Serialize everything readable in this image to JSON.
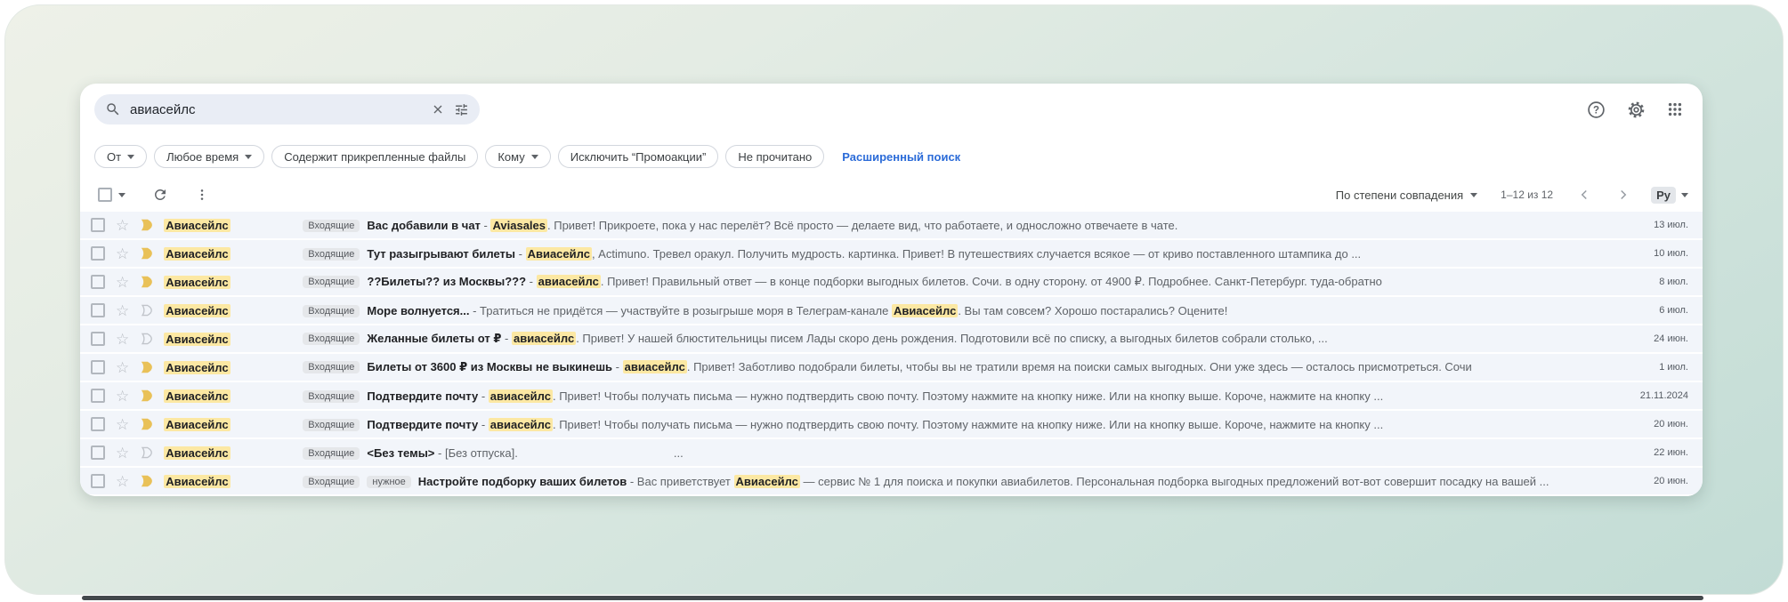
{
  "colors": {
    "accent_blue": "#2b6bd8",
    "highlight_yellow": "#fce8a3",
    "importance_yellow": "#e9c158",
    "row_background": "#f2f5fa"
  },
  "search": {
    "value": "авиасейлс",
    "search_icon": "magnifier",
    "clear_icon": "close-x",
    "options_icon": "tune-sliders"
  },
  "header": {
    "icons": [
      "help",
      "settings",
      "apps-grid"
    ]
  },
  "filters": {
    "chips": [
      {
        "label": "От",
        "dropdown": true
      },
      {
        "label": "Любое время",
        "dropdown": true
      },
      {
        "label": "Содержит прикрепленные файлы",
        "dropdown": false
      },
      {
        "label": "Кому",
        "dropdown": true
      },
      {
        "label": "Исключить “Промоакции”",
        "dropdown": false
      },
      {
        "label": "Не прочитано",
        "dropdown": false
      }
    ],
    "advanced_link": "Расширенный поиск"
  },
  "toolbar": {
    "sort_label": "По степени совпадения",
    "range_label": "1–12 из 12",
    "input_tool_label": "Ру",
    "icons": [
      "select-all-checkbox",
      "refresh",
      "more-vert",
      "chevron-left",
      "chevron-right"
    ]
  },
  "list": {
    "separator": "-",
    "emails": [
      {
        "sender": "Авиасейлс",
        "important": true,
        "labels": [
          "Входящие"
        ],
        "subject": "Вас добавили в чат",
        "snippet": [
          {
            "t": "Aviasales",
            "h": true
          },
          {
            "t": ". Привет! Прикроете, пока у нас перелёт? Всё просто — делаете вид, что работаете, и односложно отвечаете в чате."
          }
        ],
        "date": "13 июл."
      },
      {
        "sender": "Авиасейлс",
        "important": true,
        "labels": [
          "Входящие"
        ],
        "subject": "Тут разыгрывают билеты",
        "snippet": [
          {
            "t": "Авиасейлс",
            "h": true
          },
          {
            "t": ", Actimuno. Тревел оракул. Получить мудрость. картинка. Привет! В путешествиях случается всякое — от криво поставленного штампика до ..."
          }
        ],
        "date": "10 июл."
      },
      {
        "sender": "Авиасейлс",
        "important": true,
        "labels": [
          "Входящие"
        ],
        "subject": "??Билеты?? из Москвы???",
        "snippet": [
          {
            "t": "авиасейлс",
            "h": true
          },
          {
            "t": ". Привет! Правильный ответ — в конце подборки выгодных билетов. Сочи. в одну сторону. от 4900 ₽. Подробнее. Санкт-Петербург. туда-обратно"
          }
        ],
        "date": "8 июл."
      },
      {
        "sender": "Авиасейлс",
        "important": false,
        "labels": [
          "Входящие"
        ],
        "subject": "Море волнуется...",
        "snippet": [
          {
            "t": "Тратиться не придётся — участвуйте в розыгрыше моря в Телеграм-канале "
          },
          {
            "t": "Авиасейлс",
            "h": true
          },
          {
            "t": ". Вы там совсем? Хорошо постарались? Оцените!"
          }
        ],
        "date": "6 июл."
      },
      {
        "sender": "Авиасейлс",
        "important": false,
        "labels": [
          "Входящие"
        ],
        "subject": "Желанные билеты от ₽",
        "snippet": [
          {
            "t": "авиасейлс",
            "h": true
          },
          {
            "t": ". Привет! У нашей блюстительницы писем Лады скоро день рождения. Подготовили всё по списку, а выгодных билетов собрали столько, ..."
          }
        ],
        "date": "24 июн."
      },
      {
        "sender": "Авиасейлс",
        "important": true,
        "labels": [
          "Входящие"
        ],
        "subject": "Билеты от 3600 ₽ из Москвы не выкинешь",
        "snippet": [
          {
            "t": "авиасейлс",
            "h": true
          },
          {
            "t": ". Привет! Заботливо подобрали билеты, чтобы вы не тратили время на поиски самых выгодных. Они уже здесь — осталось присмотреться. Сочи"
          }
        ],
        "date": "1 июл."
      },
      {
        "sender": "Авиасейлс",
        "important": true,
        "labels": [
          "Входящие"
        ],
        "subject": "Подтвердите почту",
        "snippet": [
          {
            "t": "авиасейлс",
            "h": true
          },
          {
            "t": ". Привет! Чтобы получать письма — нужно подтвердить свою почту. Поэтому нажмите на кнопку ниже. Или на кнопку выше. Короче, нажмите на кнопку ..."
          }
        ],
        "date": "21.11.2024"
      },
      {
        "sender": "Авиасейлс",
        "important": true,
        "labels": [
          "Входящие"
        ],
        "subject": "Подтвердите почту",
        "snippet": [
          {
            "t": "авиасейлс",
            "h": true
          },
          {
            "t": ". Привет! Чтобы получать письма — нужно подтвердить свою почту. Поэтому нажмите на кнопку ниже. Или на кнопку выше. Короче, нажмите на кнопку ..."
          }
        ],
        "date": "20 июн."
      },
      {
        "sender": "Авиасейлс",
        "important": false,
        "labels": [
          "Входящие"
        ],
        "subject": "<Без темы>",
        "snippet": [
          {
            "t": "[Без отпуска]."
          },
          {
            "t": "...",
            "gap": true
          }
        ],
        "date": "22 июн."
      },
      {
        "sender": "Авиасейлс",
        "important": true,
        "labels": [
          "Входящие",
          "нужное"
        ],
        "subject": "Настройте подборку ваших билетов",
        "snippet": [
          {
            "t": "Вас приветствует "
          },
          {
            "t": "Авиасейлс",
            "h": true
          },
          {
            "t": " — сервис № 1 для поиска и покупки авиабилетов. Персональная подборка выгодных предложений вот-вот совершит посадку на вашей ..."
          }
        ],
        "date": "20 июн."
      }
    ]
  }
}
